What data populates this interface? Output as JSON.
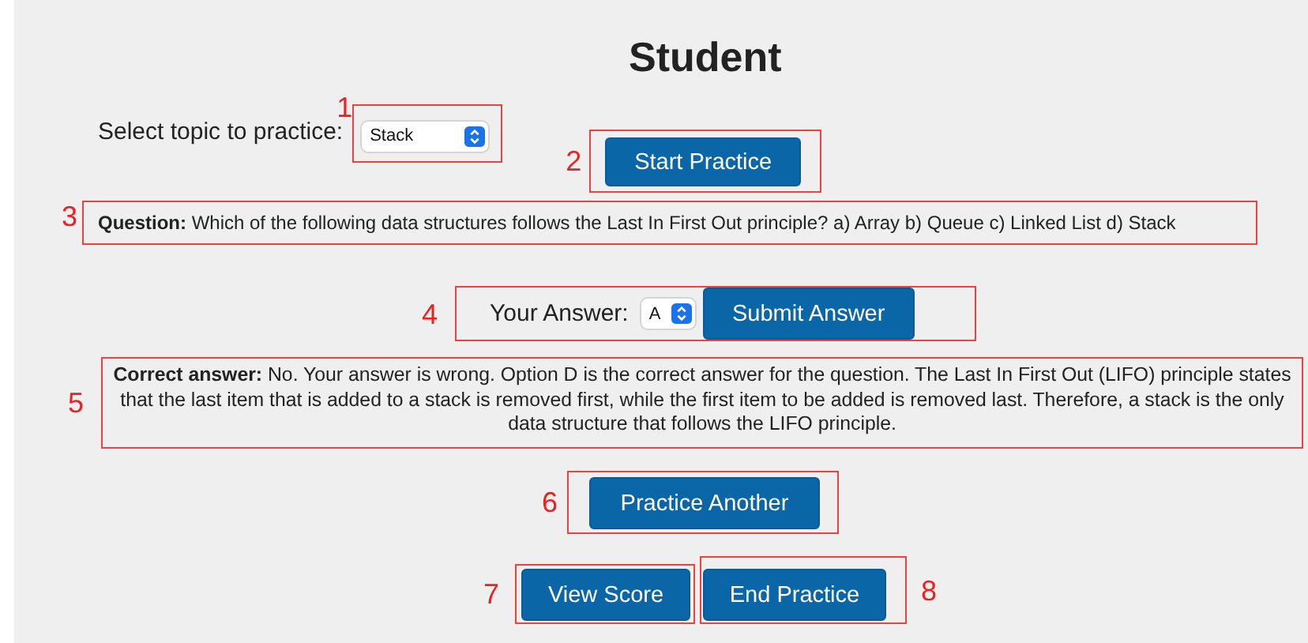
{
  "title": "Student",
  "topic": {
    "label": "Select topic to practice:",
    "value": "Stack",
    "annotation": "1"
  },
  "start_button": {
    "label": "Start Practice",
    "annotation": "2"
  },
  "question": {
    "text": "**Question:** Which of the following data structures follows the Last In First Out principle? a) Array b) Queue c) Linked List d) Stack",
    "annotation": "3"
  },
  "answer": {
    "label": "Your Answer:",
    "value": "A",
    "submit_label": "Submit Answer",
    "annotation": "4"
  },
  "feedback": {
    "text": "**Correct answer:** No. Your answer is wrong. Option D is the correct answer for the question. The Last In First Out (LIFO) principle states that the last item that is added to a stack is removed first, while the first item to be added is removed last. Therefore, a stack is the only data structure that follows the LIFO principle.",
    "annotation": "5"
  },
  "buttons": [
    {
      "label": "Practice Another",
      "annotation": "6"
    },
    {
      "label": "View Score",
      "annotation": "7"
    },
    {
      "label": "End Practice",
      "annotation": "8"
    }
  ]
}
